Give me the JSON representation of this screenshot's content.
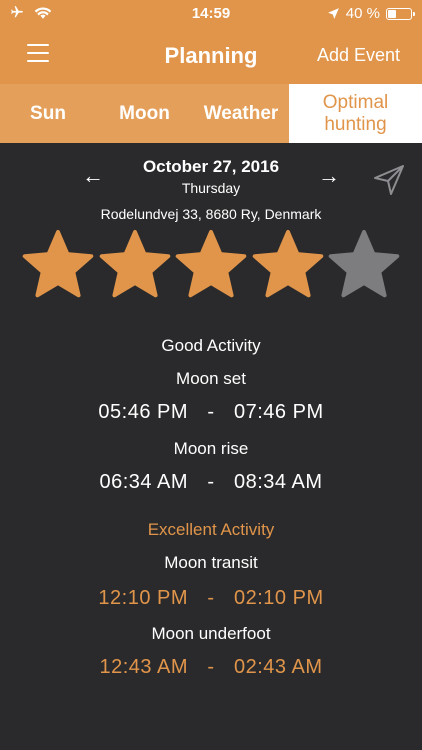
{
  "status": {
    "time": "14:59",
    "battery": "40 %",
    "battery_level": 0.4
  },
  "navbar": {
    "title": "Planning",
    "action": "Add Event"
  },
  "tabs": [
    {
      "label": "Sun"
    },
    {
      "label": "Moon"
    },
    {
      "label": "Weather"
    },
    {
      "label": "Optimal hunting"
    }
  ],
  "date": {
    "main": "October 27, 2016",
    "weekday": "Thursday",
    "prev": "←",
    "next": "→"
  },
  "address": "Rodelundvej 33, 8680 Ry, Denmark",
  "rating": {
    "value": 4,
    "max": 5,
    "active_color": "#e0954a",
    "inactive_color": "#7d7d7f"
  },
  "good": {
    "heading": "Good Activity",
    "moon_set": {
      "label": "Moon set",
      "start": "05:46 PM",
      "sep": "-",
      "end": "07:46 PM"
    },
    "moon_rise": {
      "label": "Moon rise",
      "start": "06:34 AM",
      "sep": "-",
      "end": "08:34 AM"
    }
  },
  "excellent": {
    "heading": "Excellent Activity",
    "moon_transit": {
      "label": "Moon transit",
      "start": "12:10 PM",
      "sep": "-",
      "end": "02:10 PM"
    },
    "moon_underfoot": {
      "label": "Moon underfoot",
      "start": "12:43 AM",
      "sep": "-",
      "end": "02:43 AM"
    }
  },
  "colors": {
    "accent": "#e0954a",
    "tab_bar": "#e4a05b",
    "background": "#2a2a2c"
  },
  "icons": [
    "airplane-icon",
    "wifi-icon",
    "location-arrow-icon",
    "battery-icon",
    "hamburger-icon",
    "send-location-icon",
    "star-icon"
  ]
}
